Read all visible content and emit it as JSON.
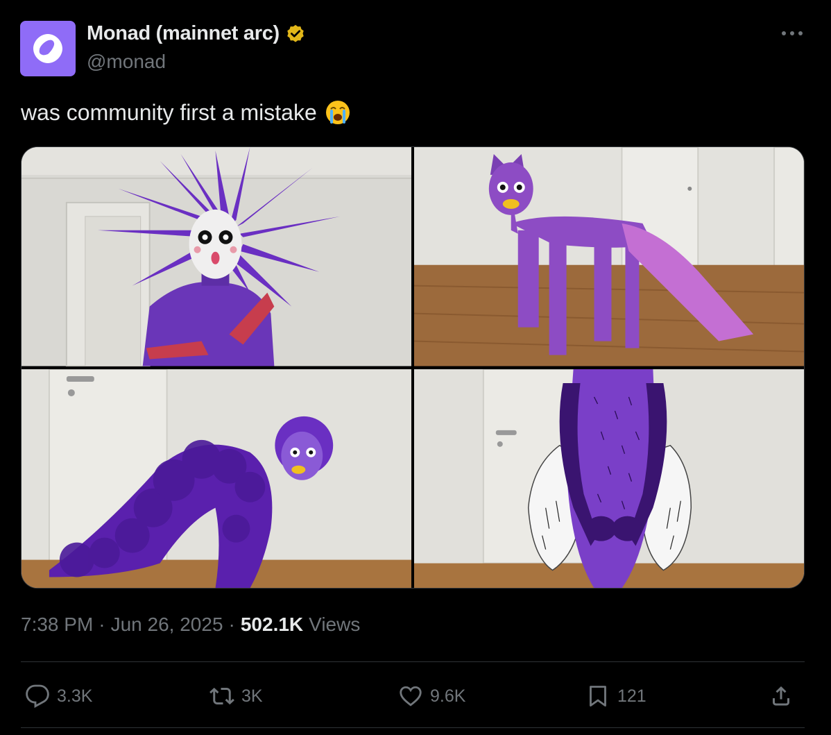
{
  "author": {
    "display_name": "Monad (mainnet arc)",
    "handle": "@monad",
    "verified": true,
    "avatar_color": "#8f6cf7"
  },
  "tweet": {
    "text": "was community first a mistake",
    "emoji": "loudly-crying-face",
    "media": [
      {
        "name": "spiky-headdress-costume"
      },
      {
        "name": "cat-mermaid-costume"
      },
      {
        "name": "feather-boa-costume"
      },
      {
        "name": "hairy-fly-costume"
      }
    ]
  },
  "meta": {
    "time": "7:38 PM",
    "separator": "·",
    "date": "Jun 26, 2025",
    "views_count": "502.1K",
    "views_label": "Views"
  },
  "actions": {
    "reply_count": "3.3K",
    "repost_count": "3K",
    "like_count": "9.6K",
    "bookmark_count": "121"
  },
  "colors": {
    "background": "#000000",
    "text_primary": "#e7e9ea",
    "text_secondary": "#71767b",
    "verified_gold": "#e2b719",
    "divider": "#2f3336"
  }
}
